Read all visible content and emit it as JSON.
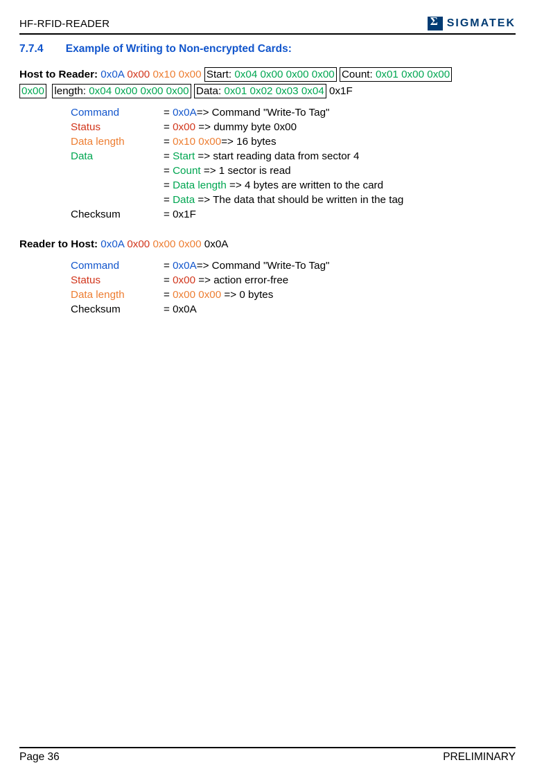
{
  "header": {
    "title": "HF-RFID-READER",
    "logoName": "SIGMATEK"
  },
  "section": {
    "number": "7.7.4",
    "title": "Example of Writing to Non-encrypted Cards:"
  },
  "hostToReader": {
    "label": "Host to Reader: ",
    "seq": {
      "p1": "0x0A",
      "p2": "0x00",
      "p3": "0x10 0x00",
      "box1a": "Start: ",
      "box1b": "0x04 0x00 0x00 0x00",
      "box2a": "Count: ",
      "box2b": "0x01 0x00 0x00",
      "box2c": "0x00",
      "box3a": " length: ",
      "box3b": "0x04 0x00 0x00 0x00",
      "box4a": "Data: ",
      "box4b": "0x01 0x02 0x03 0x04",
      "tail": " 0x1F"
    },
    "rows": {
      "r1l": "Command",
      "r1eq": "= ",
      "r1v": "0x0A",
      "r1d": "=> Command \"Write-To Tag\"",
      "r2l": "Status",
      "r2eq": "= ",
      "r2v": "0x00 ",
      "r2d": "=> dummy byte 0x00",
      "r3l": "Data length",
      "r3eq": "=   ",
      "r3v": "0x10 0x00",
      "r3d": "=> 16 bytes",
      "r4l": "Data",
      "r4eq": "= ",
      "r4v": "Start ",
      "r4d": "=> start reading data from sector 4",
      "r5eq": "= ",
      "r5v": "Count ",
      "r5d": "=> 1 sector is read",
      "r6eq": "= ",
      "r6v": "Data length ",
      "r6d": "=> 4 bytes are written to the card",
      "r7eq": "= ",
      "r7v": "Data ",
      "r7d": "=> The data that should be written in the tag",
      "r8l": "Checksum",
      "r8eq": "= 0x1F"
    }
  },
  "readerToHost": {
    "label": "Reader to Host: ",
    "seq": {
      "p1": "0x0A",
      "p2": "0x00",
      "p3": "0x00 0x00",
      "tail": " 0x0A"
    },
    "rows": {
      "r1l": "Command",
      "r1eq": "= ",
      "r1v": "0x0A",
      "r1d": "=> Command \"Write-To Tag\"",
      "r2l": "Status",
      "r2eq": "= ",
      "r2v": "0x00 ",
      "r2d": "=> action error-free",
      "r3l": "Data length",
      "r3eq": "=  ",
      "r3v": "0x00 0x00 ",
      "r3d": "=> 0 bytes",
      "r4l": "Checksum",
      "r4eq": "= 0x0A"
    }
  },
  "footer": {
    "left": "Page 36",
    "right": "PRELIMINARY"
  }
}
